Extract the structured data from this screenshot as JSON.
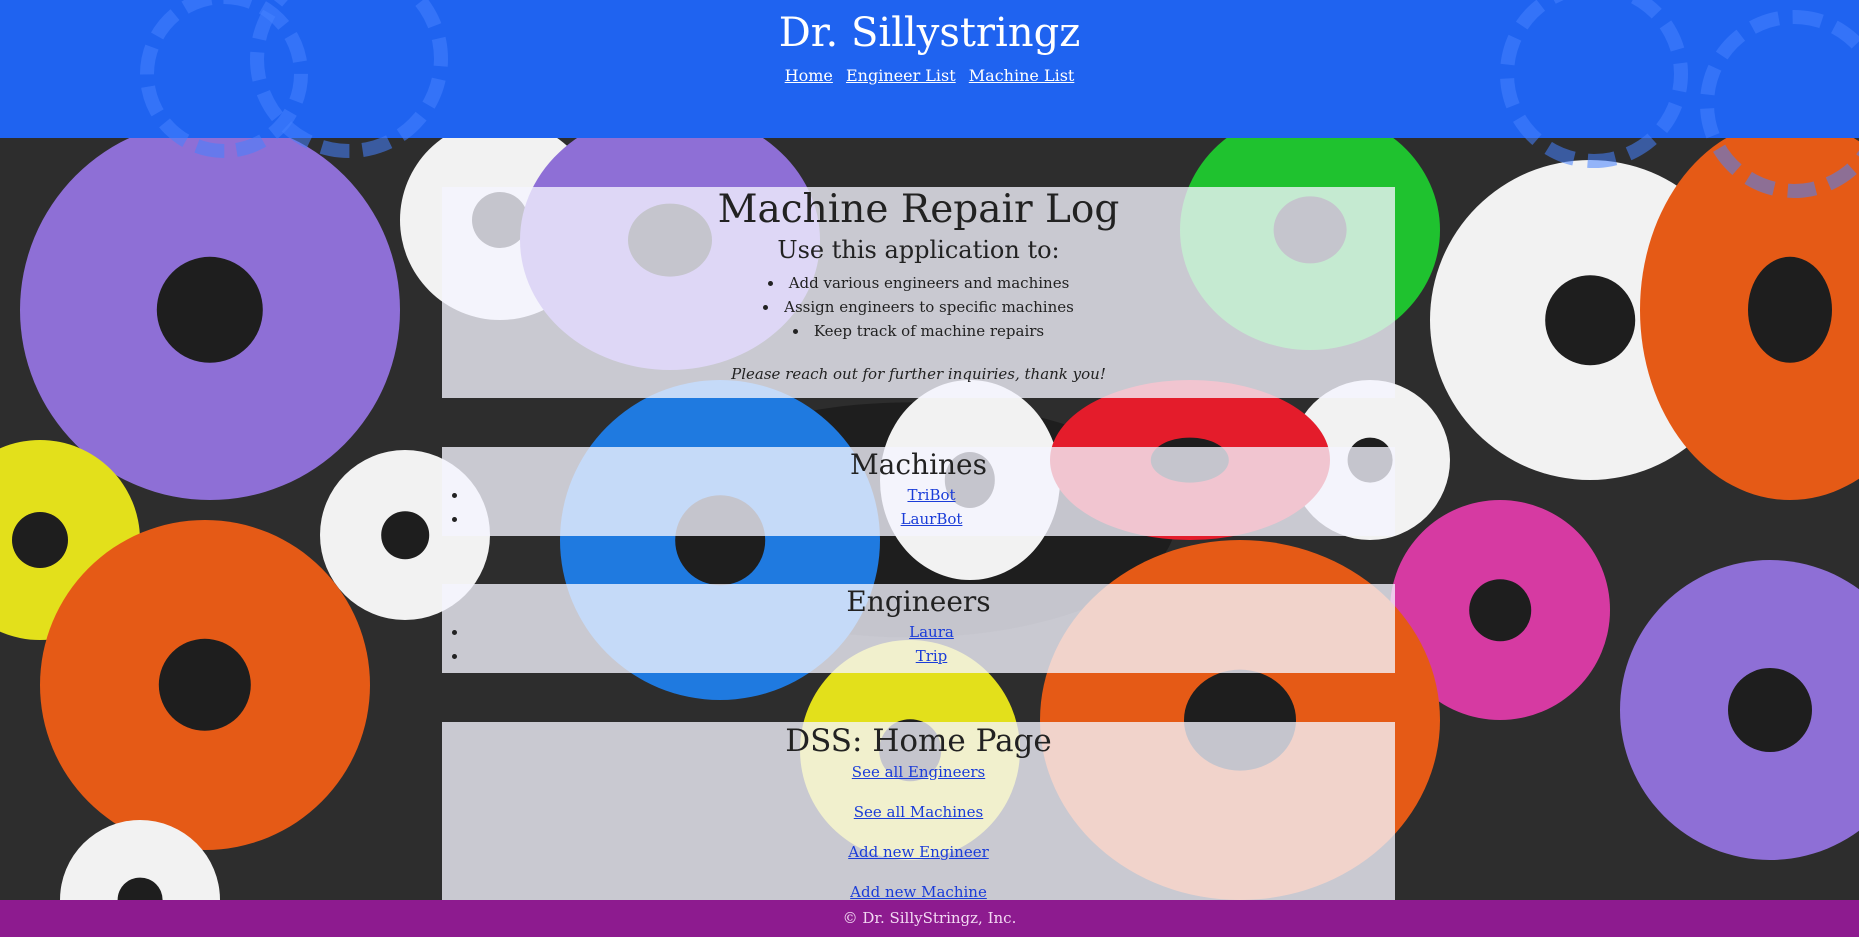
{
  "header": {
    "title": "Dr. Sillystringz",
    "nav": [
      "Home",
      "Engineer List",
      "Machine List"
    ],
    "color": "#1f63f0"
  },
  "intro": {
    "title": "Machine Repair Log",
    "subtitle": "Use this application to:",
    "items": [
      "Add various engineers and machines",
      "Assign engineers to specific machines",
      "Keep track of machine repairs"
    ],
    "note": "Please reach out for further inquiries, thank you!"
  },
  "machines": {
    "title": "Machines",
    "items": [
      "TriBot",
      "LaurBot"
    ]
  },
  "engineers": {
    "title": "Engineers",
    "items": [
      "Laura",
      "Trip"
    ]
  },
  "home": {
    "title": "DSS: Home Page",
    "links": [
      "See all Engineers",
      "See all Machines",
      "Add new Engineer",
      "Add new Machine"
    ]
  },
  "footer": {
    "text": "© Dr. SillyStringz, Inc.",
    "color": "#8d1b8f"
  },
  "background": {
    "icon": "gears-background",
    "colors": [
      "#8e6fd6",
      "#e55a16",
      "#f2f2f2",
      "#e3e01b",
      "#1f7ae0",
      "#1fc22f",
      "#d63aa2",
      "#e41c2b"
    ]
  }
}
